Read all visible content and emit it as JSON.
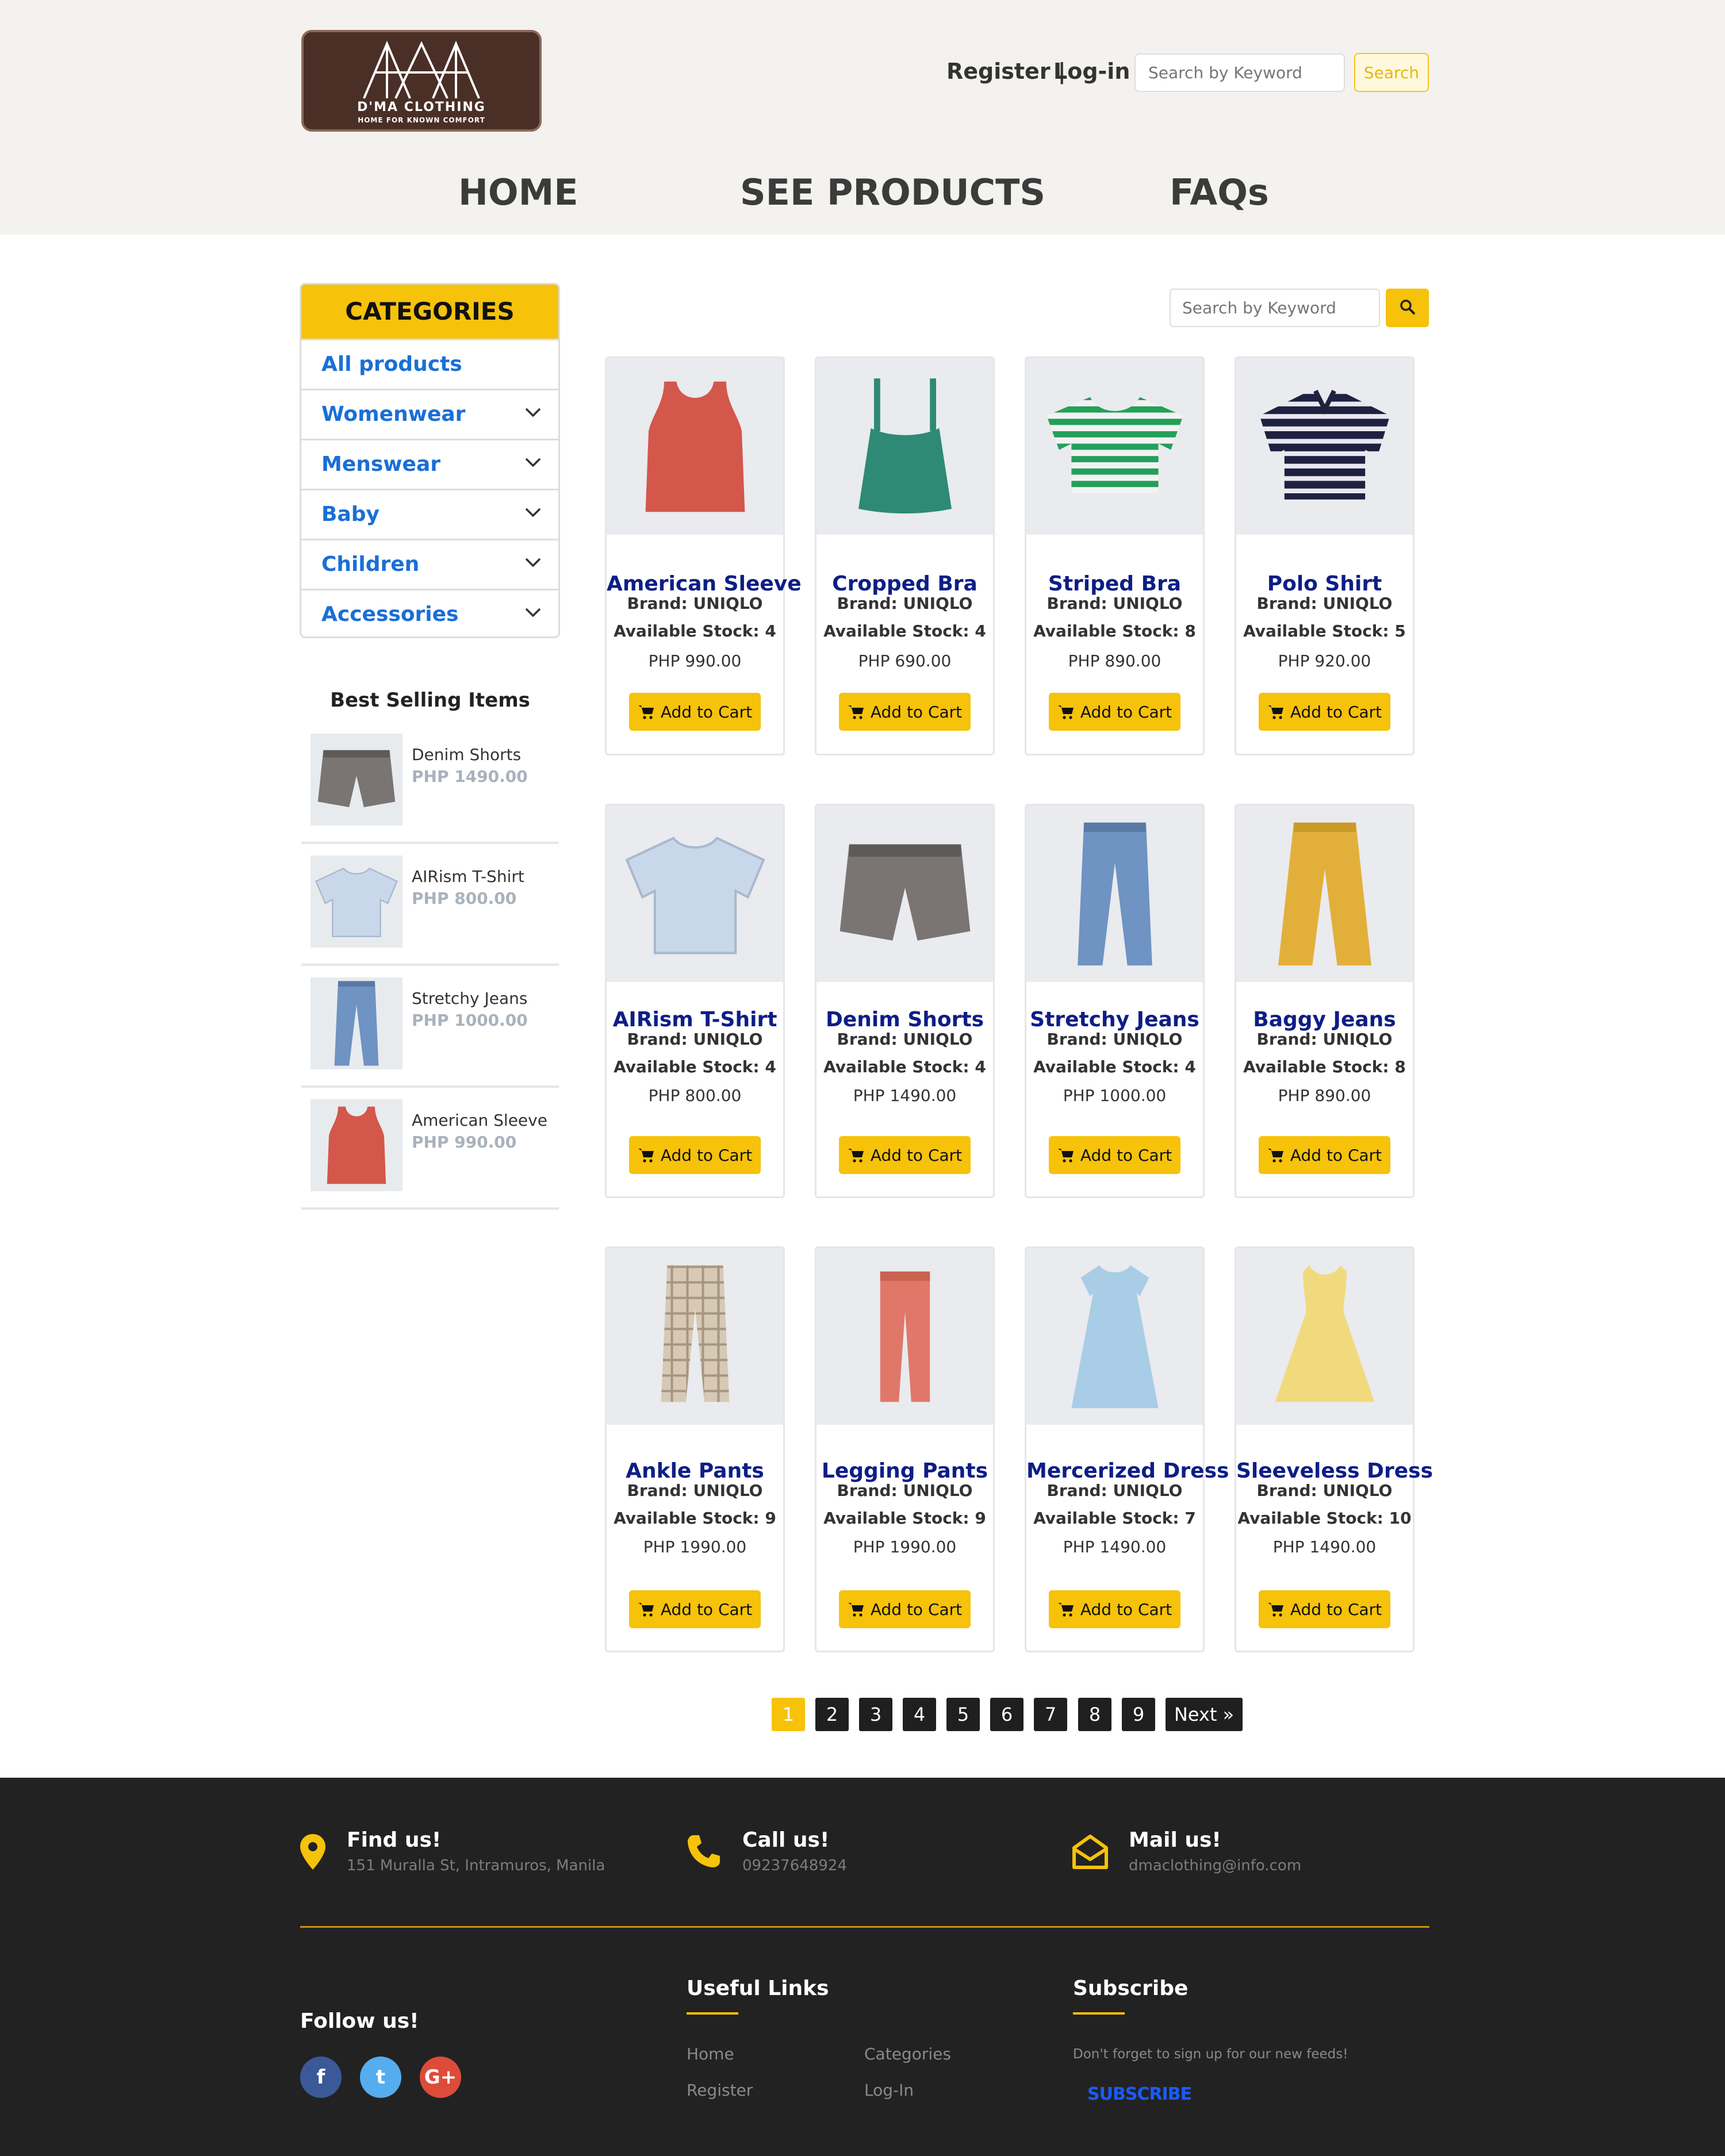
{
  "brand": {
    "name": "D'MA CLOTHING",
    "tagline": "HOME FOR KNOWN COMFORT"
  },
  "header": {
    "register_label": "Register |",
    "login_label": "Log-in |",
    "search_placeholder": "Search by Keyword",
    "search_button": "Search"
  },
  "nav": {
    "home": "HOME",
    "products": "SEE PRODUCTS",
    "faqs": "FAQs"
  },
  "categories": {
    "title": "CATEGORIES",
    "items": [
      {
        "label": "All products",
        "has_submenu": false
      },
      {
        "label": "Womenwear",
        "has_submenu": true
      },
      {
        "label": "Menswear",
        "has_submenu": true
      },
      {
        "label": "Baby",
        "has_submenu": true
      },
      {
        "label": "Children",
        "has_submenu": true
      },
      {
        "label": "Accessories",
        "has_submenu": true
      }
    ]
  },
  "best_selling": {
    "title": "Best Selling Items",
    "items": [
      {
        "name": "Denim Shorts",
        "price": "PHP 1490.00",
        "icon": "shorts-grey"
      },
      {
        "name": "AIRism T-Shirt",
        "price": "PHP 800.00",
        "icon": "tshirt-lightblue"
      },
      {
        "name": "Stretchy Jeans",
        "price": "PHP 1000.00",
        "icon": "jeans-blue"
      },
      {
        "name": "American Sleeve",
        "price": "PHP 990.00",
        "icon": "tank-red"
      }
    ]
  },
  "main_search": {
    "placeholder": "Search by Keyword"
  },
  "products": [
    {
      "name": "American Sleeve",
      "brand": "Brand: UNIQLO",
      "stock": "Available Stock: 4",
      "price": "PHP 990.00",
      "button": "Add to Cart",
      "icon": "tank-red"
    },
    {
      "name": "Cropped Bra",
      "brand": "Brand: UNIQLO",
      "stock": "Available Stock: 4",
      "price": "PHP 690.00",
      "button": "Add to Cart",
      "icon": "cami-green"
    },
    {
      "name": "Striped Bra",
      "brand": "Brand: UNIQLO",
      "stock": "Available Stock: 8",
      "price": "PHP 890.00",
      "button": "Add to Cart",
      "icon": "crop-striped-green"
    },
    {
      "name": "Polo Shirt",
      "brand": "Brand: UNIQLO",
      "stock": "Available Stock: 5",
      "price": "PHP 920.00",
      "button": "Add to Cart",
      "icon": "polo-navy"
    },
    {
      "name": "AIRism T-Shirt",
      "brand": "Brand: UNIQLO",
      "stock": "Available Stock: 4",
      "price": "PHP 800.00",
      "button": "Add to Cart",
      "icon": "tshirt-lightblue"
    },
    {
      "name": "Denim Shorts",
      "brand": "Brand: UNIQLO",
      "stock": "Available Stock: 4",
      "price": "PHP 1490.00",
      "button": "Add to Cart",
      "icon": "shorts-grey"
    },
    {
      "name": "Stretchy Jeans",
      "brand": "Brand: UNIQLO",
      "stock": "Available Stock: 4",
      "price": "PHP 1000.00",
      "button": "Add to Cart",
      "icon": "jeans-blue"
    },
    {
      "name": "Baggy Jeans",
      "brand": "Brand: UNIQLO",
      "stock": "Available Stock: 8",
      "price": "PHP 890.00",
      "button": "Add to Cart",
      "icon": "pants-yellow"
    },
    {
      "name": "Ankle Pants",
      "brand": "Brand: UNIQLO",
      "stock": "Available Stock: 9",
      "price": "PHP 1990.00",
      "button": "Add to Cart",
      "icon": "pants-plaid"
    },
    {
      "name": "Legging Pants",
      "brand": "Brand: UNIQLO",
      "stock": "Available Stock: 9",
      "price": "PHP 1990.00",
      "button": "Add to Cart",
      "icon": "pants-coral"
    },
    {
      "name": "Mercerized Dress",
      "brand": "Brand: UNIQLO",
      "stock": "Available Stock: 7",
      "price": "PHP 1490.00",
      "button": "Add to Cart",
      "icon": "dress-blue"
    },
    {
      "name": "Sleeveless Dress",
      "brand": "Brand: UNIQLO",
      "stock": "Available Stock: 10",
      "price": "PHP 1490.00",
      "button": "Add to Cart",
      "icon": "dress-yellow"
    }
  ],
  "pagination": {
    "pages": [
      "1",
      "2",
      "3",
      "4",
      "5",
      "6",
      "7",
      "8",
      "9"
    ],
    "current": "1",
    "next": "Next »"
  },
  "footer": {
    "find_title": "Find us!",
    "find_text": "151 Muralla St, Intramuros, Manila",
    "call_title": "Call us!",
    "call_text": "09237648924",
    "mail_title": "Mail us!",
    "mail_text": "dmaclothing@info.com",
    "follow_title": "Follow us!",
    "links_title": "Useful Links",
    "links": [
      "Home",
      "Categories",
      "Register",
      "Log-In"
    ],
    "subscribe_title": "Subscribe",
    "subscribe_text": "Don't forget to sign up for our new feeds!",
    "subscribe_link": "SUBSCRIBE",
    "socials": [
      {
        "name": "facebook",
        "glyph": "f",
        "color": "#3b5998"
      },
      {
        "name": "twitter",
        "glyph": "t",
        "color": "#55acee"
      },
      {
        "name": "google-plus",
        "glyph": "G+",
        "color": "#dd4b39"
      }
    ]
  },
  "colors": {
    "accent": "#f6c20a",
    "header_bg": "#f4f2ef",
    "footer_bg": "#222222",
    "product_title": "#0d1e86",
    "category_link": "#1a6fd6"
  }
}
